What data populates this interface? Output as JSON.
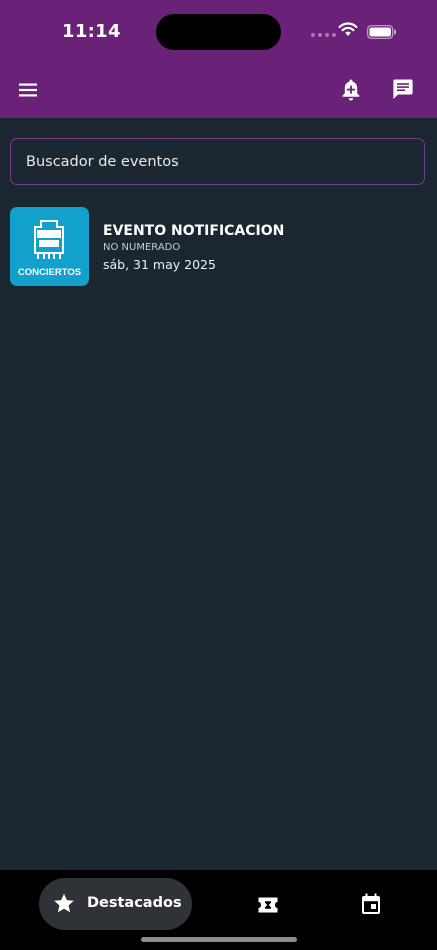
{
  "status_bar": {
    "time": "11:14"
  },
  "app_bar": {
    "menu_icon": "menu-icon",
    "notification_icon": "bell-plus-icon",
    "message_icon": "message-icon"
  },
  "search": {
    "placeholder": "Buscador de eventos",
    "value": ""
  },
  "events": [
    {
      "title": "EVENTO NOTIFICACION",
      "subtitle": "NO NUMERADO",
      "date": "sáb, 31 may 2025",
      "thumbnail_label": "CONCIERTOS",
      "thumbnail_color": "#12a1cc"
    }
  ],
  "bottom_nav": {
    "items": [
      {
        "label": "Destacados",
        "icon": "star-icon",
        "active": true
      },
      {
        "label": "",
        "icon": "ticket-icon",
        "active": false
      },
      {
        "label": "",
        "icon": "calendar-icon",
        "active": false
      }
    ]
  },
  "colors": {
    "primary": "#6a2178",
    "background": "#1b2730",
    "nav_background": "#000000",
    "nav_active": "#2f3338"
  }
}
